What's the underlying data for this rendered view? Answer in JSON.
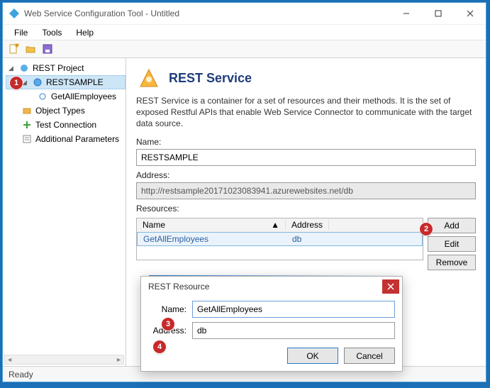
{
  "window": {
    "title": "Web Service Configuration Tool - Untitled"
  },
  "menu": {
    "file": "File",
    "tools": "Tools",
    "help": "Help"
  },
  "tree": {
    "root": "REST Project",
    "service": "RESTSAMPLE",
    "op": "GetAllEmployees",
    "objtypes": "Object Types",
    "testconn": "Test Connection",
    "addparams": "Additional Parameters"
  },
  "panel": {
    "heading": "REST Service",
    "desc": "REST Service is a container for a set of resources and their methods. It is the set of exposed Restful APIs that enable Web Service Connector to communicate with the target data source.",
    "name_label": "Name:",
    "name_value": "RESTSAMPLE",
    "addr_label": "Address:",
    "addr_value": "http://restsample20171023083941.azurewebsites.net/db",
    "res_label": "Resources:",
    "col_name": "Name",
    "col_addr": "Address",
    "row_name": "GetAllEmployees",
    "row_addr": "db",
    "btn_add": "Add",
    "btn_edit": "Edit",
    "btn_remove": "Remove"
  },
  "dialog": {
    "title": "REST Resource",
    "name_label": "Name:",
    "name_value": "GetAllEmployees",
    "addr_label": "Address:",
    "addr_value": "db",
    "ok": "OK",
    "cancel": "Cancel"
  },
  "status": {
    "ready": "Ready"
  },
  "callouts": {
    "c1": "1",
    "c2": "2",
    "c3": "3",
    "c4": "4"
  }
}
